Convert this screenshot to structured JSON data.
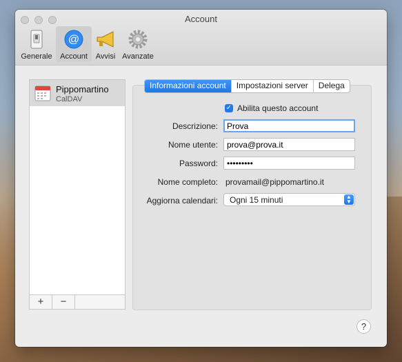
{
  "window": {
    "title": "Account"
  },
  "toolbar": {
    "items": [
      {
        "label": "Generale",
        "icon": "switch-icon"
      },
      {
        "label": "Account",
        "icon": "at-sign-icon",
        "active": true
      },
      {
        "label": "Avvisi",
        "icon": "megaphone-icon"
      },
      {
        "label": "Avanzate",
        "icon": "gear-icon"
      }
    ]
  },
  "sidebar": {
    "accounts": [
      {
        "name": "Pippomartino",
        "type": "CalDAV",
        "icon": "calendar-icon"
      }
    ],
    "footer": {
      "add": "+",
      "remove": "−"
    }
  },
  "tabs": [
    {
      "label": "Informazioni account",
      "active": true
    },
    {
      "label": "Impostazioni server",
      "active": false
    },
    {
      "label": "Delega",
      "active": false
    }
  ],
  "form": {
    "enable_label": "Abilita questo account",
    "enable_checked": true,
    "description_label": "Descrizione:",
    "description_value": "Prova",
    "username_label": "Nome utente:",
    "username_value": "prova@prova.it",
    "password_label": "Password:",
    "password_value": "•••••••••",
    "fullname_label": "Nome completo:",
    "fullname_value": "provamail@pippomartino.it",
    "refresh_label": "Aggiorna calendari:",
    "refresh_value": "Ogni 15 minuti"
  },
  "help": {
    "label": "?"
  },
  "colors": {
    "accent": "#1c77ea",
    "window_bg": "#ececec"
  }
}
